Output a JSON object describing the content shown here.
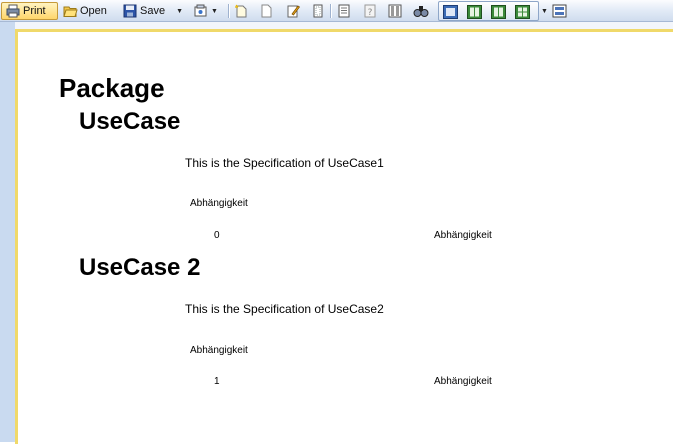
{
  "toolbar": {
    "print_label": "Print",
    "open_label": "Open",
    "save_label": "Save",
    "icons": [
      "printer-icon",
      "folder-open-icon",
      "floppy-save-icon",
      "export-icon",
      "new-page-icon",
      "blank-page-icon",
      "edit-icon",
      "page-setup-icon",
      "header-footer-icon",
      "help-page-icon",
      "columns-icon",
      "find-icon",
      "view-single-icon",
      "view-two-icon",
      "view-book-icon",
      "view-grid-icon",
      "multi-page-icon"
    ],
    "accent_color": "#ffd66b"
  },
  "document": {
    "package_title": "Package",
    "usecases": [
      {
        "title": "UseCase",
        "specification": "This is the Specification of UseCase1",
        "dependency_header": "Abhängigkeit",
        "dependency_index": "0",
        "dependency_value": "Abhängigkeit"
      },
      {
        "title": "UseCase 2",
        "specification": "This is the Specification of UseCase2",
        "dependency_header": "Abhängigkeit",
        "dependency_index": "1",
        "dependency_value": "Abhängigkeit"
      }
    ]
  }
}
